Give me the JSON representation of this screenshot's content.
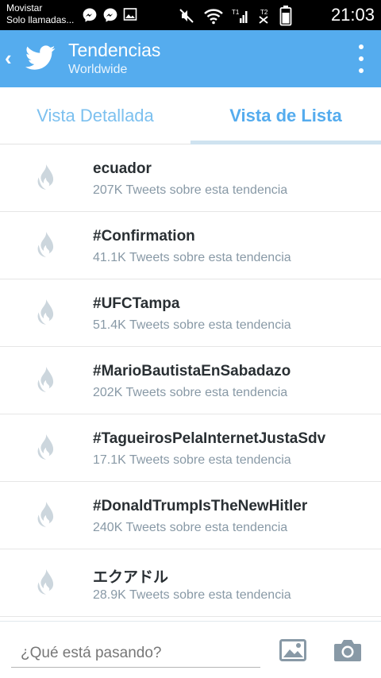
{
  "status_bar": {
    "carrier_line1": "Movistar",
    "carrier_line2": "Solo llamadas...",
    "time": "21:03"
  },
  "app_bar": {
    "title": "Tendencias",
    "subtitle": "Worldwide"
  },
  "tabs": [
    {
      "label": "Vista Detallada",
      "active": false
    },
    {
      "label": "Vista de Lista",
      "active": true
    }
  ],
  "trends": [
    {
      "name": "ecuador",
      "count": "207K Tweets sobre esta tendencia"
    },
    {
      "name": "#Confirmation",
      "count": "41.1K Tweets sobre esta tendencia"
    },
    {
      "name": "#UFCTampa",
      "count": "51.4K Tweets sobre esta tendencia"
    },
    {
      "name": "#MarioBautistaEnSabadazo",
      "count": "202K Tweets sobre esta tendencia"
    },
    {
      "name": "#TagueirosPelaInternetJustaSdv",
      "count": "17.1K Tweets sobre esta tendencia"
    },
    {
      "name": "#DonaldTrumpIsTheNewHitler",
      "count": "240K Tweets sobre esta tendencia"
    },
    {
      "name": "エクアドル",
      "count": "28.9K Tweets sobre esta tendencia"
    }
  ],
  "compose": {
    "placeholder": "¿Qué está pasando?"
  },
  "colors": {
    "brand": "#55acee",
    "flame": "#ccd6dd",
    "trend_text": "#292f33",
    "meta_text": "#8899a6"
  },
  "icons": {
    "back": "chevron-left-icon",
    "logo": "twitter-bird-icon",
    "overflow": "more-vertical-icon",
    "trend": "flame-icon",
    "photo": "photo-icon",
    "camera": "camera-icon"
  }
}
